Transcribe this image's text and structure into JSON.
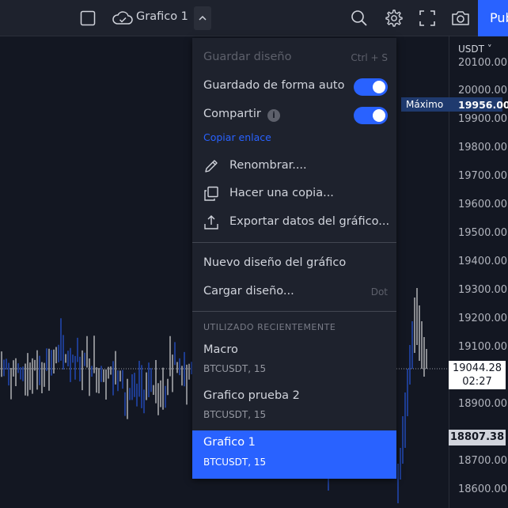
{
  "toolbar": {
    "layout_name": "Grafico 1",
    "publish_label": "Publicar",
    "icons": [
      "square-icon",
      "cloud-check-icon",
      "chevron-up-icon",
      "search-icon",
      "gear-icon",
      "fullscreen-icon",
      "camera-icon"
    ]
  },
  "price_scale": {
    "currency": "USDT",
    "ticks": [
      "20100.00",
      "20000.00",
      "19900.00",
      "19800.00",
      "19700.00",
      "19600.00",
      "19500.00",
      "19400.00",
      "19300.00",
      "19200.00",
      "19100.00",
      "18900.00",
      "18700.00",
      "18600.00"
    ],
    "max_label": "Máximo",
    "max_value": "19956.00",
    "last_price": "19044.28",
    "countdown": "02:27",
    "low_price": "18807.38"
  },
  "menu": {
    "save_layout": "Guardar diseño",
    "save_shortcut": "Ctrl + S",
    "autosave": "Guardado de forma automática",
    "share": "Compartir",
    "copy_link": "Copiar enlace",
    "rename": "Renombrar....",
    "make_copy": "Hacer una copia...",
    "export": "Exportar datos del gráfico...",
    "new_layout": "Nuevo diseño del gráfico",
    "load_layout": "Cargar diseño...",
    "load_shortcut": "Dot",
    "recent_title": "UTILIZADO RECIENTEMENTE",
    "recent": [
      {
        "title": "Macro",
        "sub": "BTCUSDT, 15"
      },
      {
        "title": "Grafico prueba 2",
        "sub": "BTCUSDT, 15"
      },
      {
        "title": "Grafico 1",
        "sub": "BTCUSDT, 15"
      }
    ]
  },
  "colors": {
    "accent": "#2962ff",
    "background": "#131722",
    "panel": "#1e222d",
    "candle_up": "#2962ff",
    "candle_down": "#ffffff"
  }
}
